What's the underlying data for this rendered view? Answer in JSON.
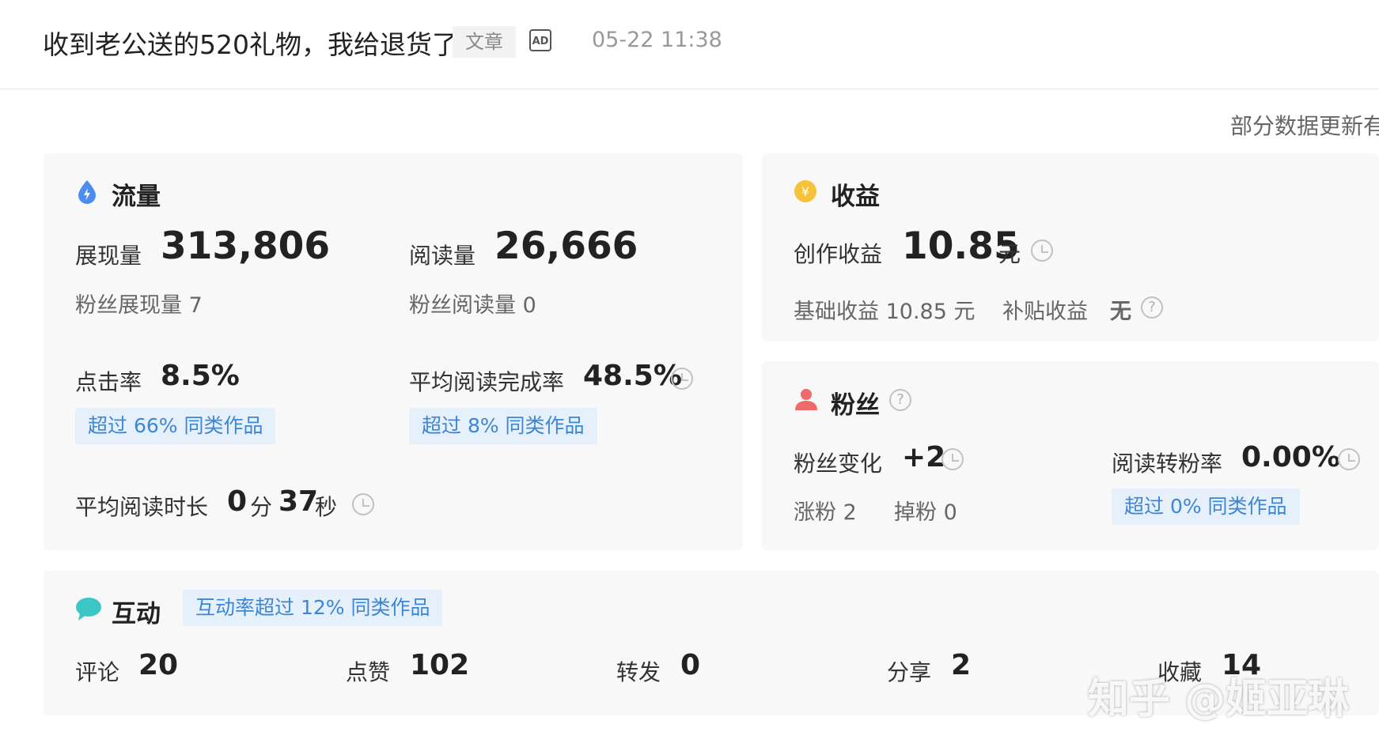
{
  "header": {
    "title": "收到老公送的520礼物，我给退货了",
    "tag": "文章",
    "ad_icon": "AD",
    "time": "05-22 11:38"
  },
  "update_note": "部分数据更新有",
  "traffic": {
    "title": "流量",
    "impressions_label": "展现量",
    "impressions": "313,806",
    "reads_label": "阅读量",
    "reads": "26,666",
    "fan_impressions": "粉丝展现量 7",
    "fan_reads": "粉丝阅读量 0",
    "ctr_label": "点击率",
    "ctr": "8.5%",
    "ctr_badge": "超过 66% 同类作品",
    "completion_label": "平均阅读完成率",
    "completion": "48.5%",
    "completion_badge": "超过 8% 同类作品",
    "avg_time_label": "平均阅读时长",
    "avg_time_min": "0",
    "avg_time_min_unit": "分",
    "avg_time_sec": "37",
    "avg_time_sec_unit": "秒"
  },
  "revenue": {
    "title": "收益",
    "creation_label": "创作收益",
    "creation_value": "10.85",
    "creation_unit": "元",
    "base": "基础收益 10.85 元",
    "subsidy_label": "补贴收益",
    "subsidy_value": "无",
    "help": "?"
  },
  "fans": {
    "title": "粉丝",
    "help": "?",
    "change_label": "粉丝变化",
    "change_value": "+2",
    "gain": "涨粉 2",
    "loss": "掉粉 0",
    "conv_label": "阅读转粉率",
    "conv_value": "0.00%",
    "conv_badge": "超过 0% 同类作品"
  },
  "interaction": {
    "title": "互动",
    "badge": "互动率超过 12% 同类作品",
    "comments_label": "评论",
    "comments": "20",
    "likes_label": "点赞",
    "likes": "102",
    "reposts_label": "转发",
    "reposts": "0",
    "shares_label": "分享",
    "shares": "2",
    "favorites_label": "收藏",
    "favorites": "14"
  },
  "watermark": "知乎 @姬亚琳",
  "colors": {
    "accent_blue": "#3d86d6",
    "badge_bg": "#e6f0fb",
    "card_bg": "#f8f8f9",
    "traffic_icon": "#4a8cf0",
    "revenue_icon": "#f7c23b",
    "fans_icon": "#ef6b6b",
    "interaction_icon": "#3cc6c6"
  },
  "icons": {
    "traffic": "drop-bolt-icon",
    "revenue": "yen-coin-icon",
    "fans": "user-icon",
    "interaction": "chat-bubble-icon"
  }
}
